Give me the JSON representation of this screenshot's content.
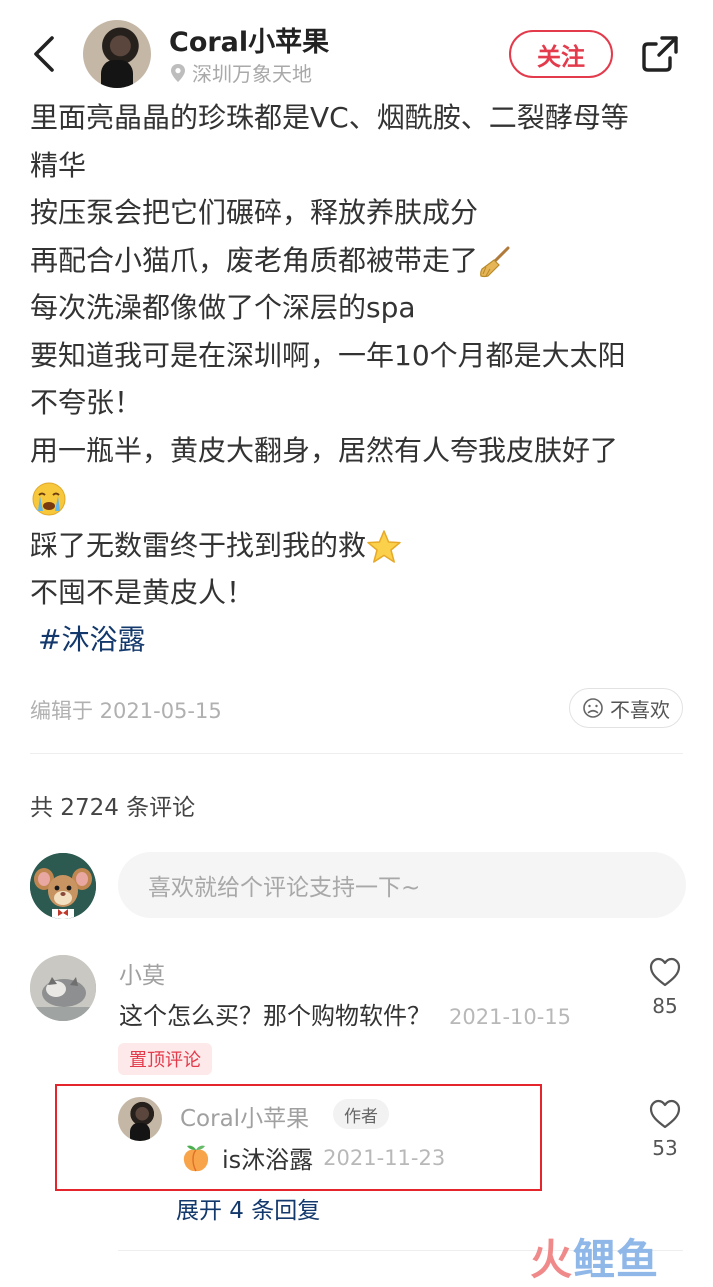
{
  "header": {
    "author_name": "Coral小苹果",
    "location": "深圳万象天地",
    "follow_label": "关注"
  },
  "post": {
    "lines": [
      "里面亮晶晶的珍珠都是VC、烟酰胺、二裂酵母等",
      "精华",
      "按压泵会把它们碾碎，释放养肤成分",
      "再配合小猫爪，废老角质都被带走了",
      "每次洗澡都像做了个深层的spa",
      "要知道我可是在深圳啊，一年10个月都是大太阳",
      "不夸张！",
      "用一瓶半，黄皮大翻身，居然有人夸我皮肤好了",
      "",
      "踩了无数雷终于找到我的救",
      "不囤不是黄皮人！"
    ],
    "hashtag": "#沐浴露",
    "edited": "编辑于 2021-05-15",
    "dislike_label": "不喜欢"
  },
  "comments_section": {
    "count_text": "共 2724 条评论",
    "input_placeholder": "喜欢就给个评论支持一下~"
  },
  "comment": {
    "username": "小莫",
    "text": "这个怎么买？那个购物软件？",
    "date": "2021-10-15",
    "likes": "85",
    "pinned_label": "置顶评论"
  },
  "reply": {
    "username": "Coral小苹果",
    "author_badge": "作者",
    "text": "is沐浴露",
    "date": "2021-11-23",
    "likes": "53",
    "expand_label": "展开 4 条回复"
  },
  "watermark": {
    "part1": "火",
    "part2": "鲤鱼"
  },
  "colors": {
    "accent_red": "#e33b4c",
    "link_blue": "#13386c"
  }
}
